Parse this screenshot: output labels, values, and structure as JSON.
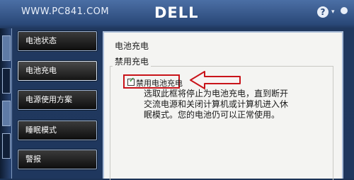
{
  "titlebar": {
    "watermark": "WWW.PC841.COM",
    "brand": "DELL",
    "help_symbol": "?",
    "caret_symbol": "▾",
    "icons": [
      "help-icon",
      "chevron-down-icon",
      "close-icon"
    ]
  },
  "sidebar": {
    "items": [
      {
        "label": "电池状态"
      },
      {
        "label": "电池充电"
      },
      {
        "label": "电源使用方案"
      },
      {
        "label": "睡眠模式"
      },
      {
        "label": "警报"
      }
    ]
  },
  "panel": {
    "heading": "电池充电",
    "group_title": "禁用充电",
    "checkbox": {
      "label": "禁用电池充电",
      "checked": true,
      "mark": "✓"
    },
    "description": "选取此框将停止为电池充电，直到断开交流电源和关闭计算机或计算机进入休眠模式。您的电池仍可以正常使用。"
  },
  "colors": {
    "annotation": "#c9141a",
    "panel_bg": "#f4f4f2",
    "nav_bg": "#1a1a1a",
    "frame": "#20385f"
  }
}
